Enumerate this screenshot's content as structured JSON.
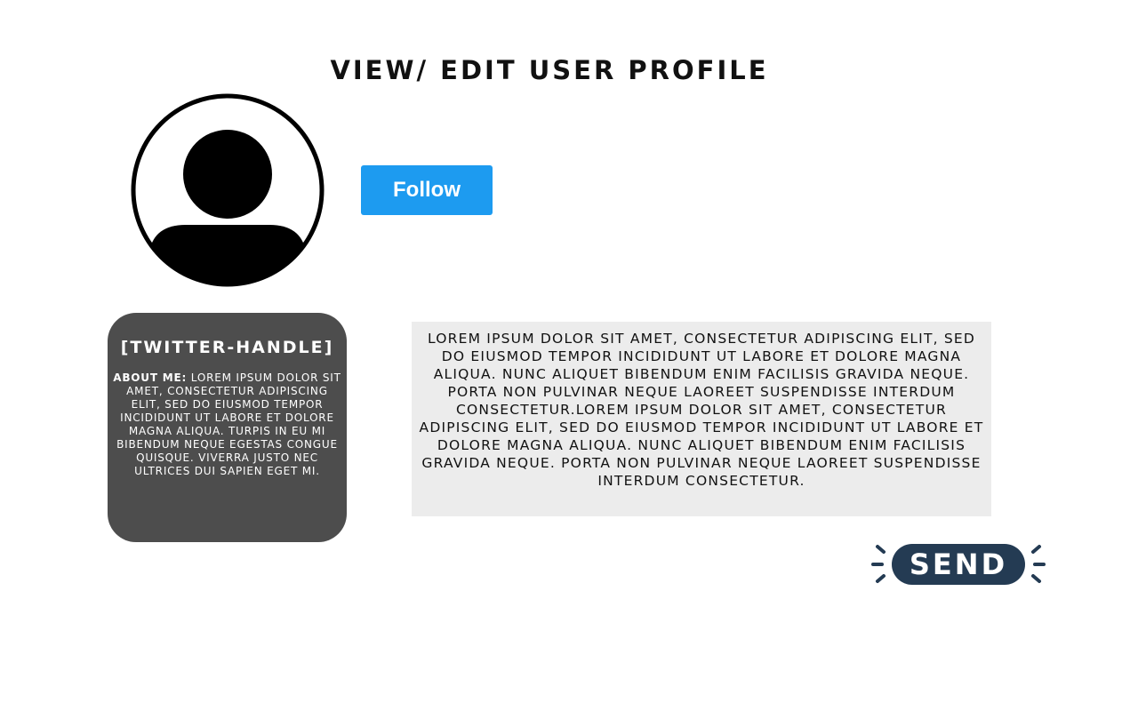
{
  "header": {
    "title": "VIEW/ EDIT USER PROFILE"
  },
  "profile": {
    "avatar_icon": "user-avatar-icon",
    "follow_label": "Follow",
    "twitter_handle": "[TWITTER-HANDLE]",
    "about_label": "ABOUT ME:",
    "about_text": "LOREM IPSUM DOLOR SIT AMET, CONSECTETUR ADIPISCING ELIT, SED DO EIUSMOD TEMPOR INCIDIDUNT UT LABORE ET DOLORE MAGNA ALIQUA. TURPIS IN EU MI BIBENDUM NEQUE EGESTAS CONGUE QUISQUE. VIVERRA JUSTO NEC ULTRICES DUI SAPIEN EGET MI."
  },
  "bio": {
    "text": "LOREM IPSUM DOLOR SIT AMET, CONSECTETUR ADIPISCING ELIT, SED DO EIUSMOD TEMPOR INCIDIDUNT UT LABORE ET DOLORE MAGNA ALIQUA. NUNC ALIQUET BIBENDUM ENIM FACILISIS GRAVIDA NEQUE. PORTA NON PULVINAR NEQUE LAOREET SUSPENDISSE INTERDUM CONSECTETUR.LOREM IPSUM DOLOR SIT AMET, CONSECTETUR ADIPISCING ELIT, SED DO EIUSMOD TEMPOR INCIDIDUNT UT LABORE ET DOLORE MAGNA ALIQUA. NUNC ALIQUET BIBENDUM ENIM FACILISIS GRAVIDA NEQUE. PORTA NON PULVINAR NEQUE LAOREET SUSPENDISSE INTERDUM CONSECTETUR."
  },
  "actions": {
    "send_label": "SEND"
  },
  "colors": {
    "follow_button": "#1d9bf0",
    "profile_card": "#4d4d4d",
    "bio_background": "#ececec",
    "send_button": "#243b53"
  }
}
